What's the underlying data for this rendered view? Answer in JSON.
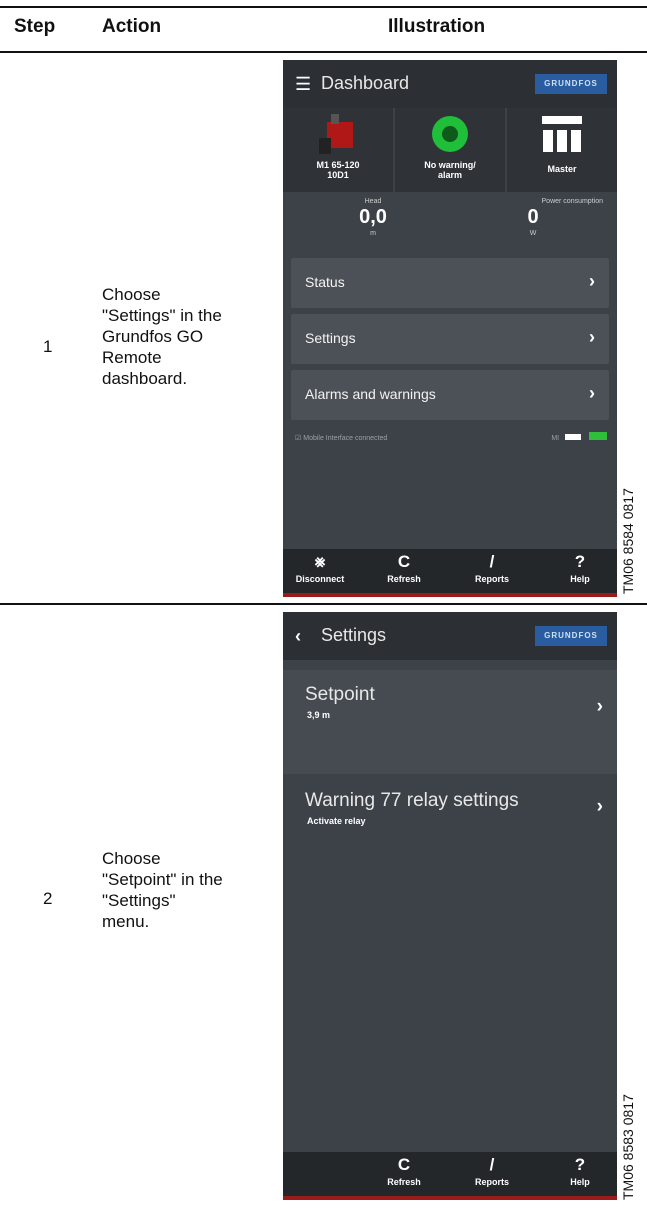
{
  "table": {
    "headers": {
      "step": "Step",
      "action": "Action",
      "illustration": "Illustration"
    },
    "rows": [
      {
        "step": "1",
        "action_lines": [
          "Choose",
          "\"Settings\" in the",
          "Grundfos GO",
          "Remote",
          "dashboard."
        ],
        "tm_code": "TM06 8584 0817",
        "screen": {
          "title": "Dashboard",
          "title_icon": "list-icon",
          "brand": "GRUNDFOS",
          "pump_name": "M1 65-120\n10D1",
          "status": "No warning/\nalarm",
          "role": "Master",
          "head_label": "Head",
          "head_value": "0,0",
          "head_unit": "m",
          "power_label": "Power consumption",
          "power_value": "0",
          "power_unit": "W",
          "menu": [
            "Status",
            "Settings",
            "Alarms and warnings"
          ],
          "footer_note": "Mobile Interface connected",
          "footer_right": "MI",
          "bottom_buttons": [
            {
              "icon": "disconnect-icon",
              "label": "Disconnect"
            },
            {
              "icon": "refresh-icon",
              "label": "Refresh"
            },
            {
              "icon": "reports-icon",
              "label": "Reports"
            },
            {
              "icon": "help-icon",
              "label": "Help"
            }
          ]
        }
      },
      {
        "step": "2",
        "action_lines": [
          "Choose",
          "\"Setpoint\" in the",
          "\"Settings\"",
          "menu."
        ],
        "tm_code": "TM06 8583 0817",
        "screen": {
          "title": "Settings",
          "title_icon": "back-chevron-icon",
          "brand": "GRUNDFOS",
          "items": [
            {
              "label": "Setpoint",
              "value": "3,9 m"
            },
            {
              "label": "Warning 77 relay settings",
              "value": "Activate relay"
            }
          ],
          "bottom_buttons": [
            {
              "icon": "refresh-icon",
              "label": "Refresh"
            },
            {
              "icon": "reports-icon",
              "label": "Reports"
            },
            {
              "icon": "help-icon",
              "label": "Help"
            }
          ]
        }
      }
    ]
  }
}
